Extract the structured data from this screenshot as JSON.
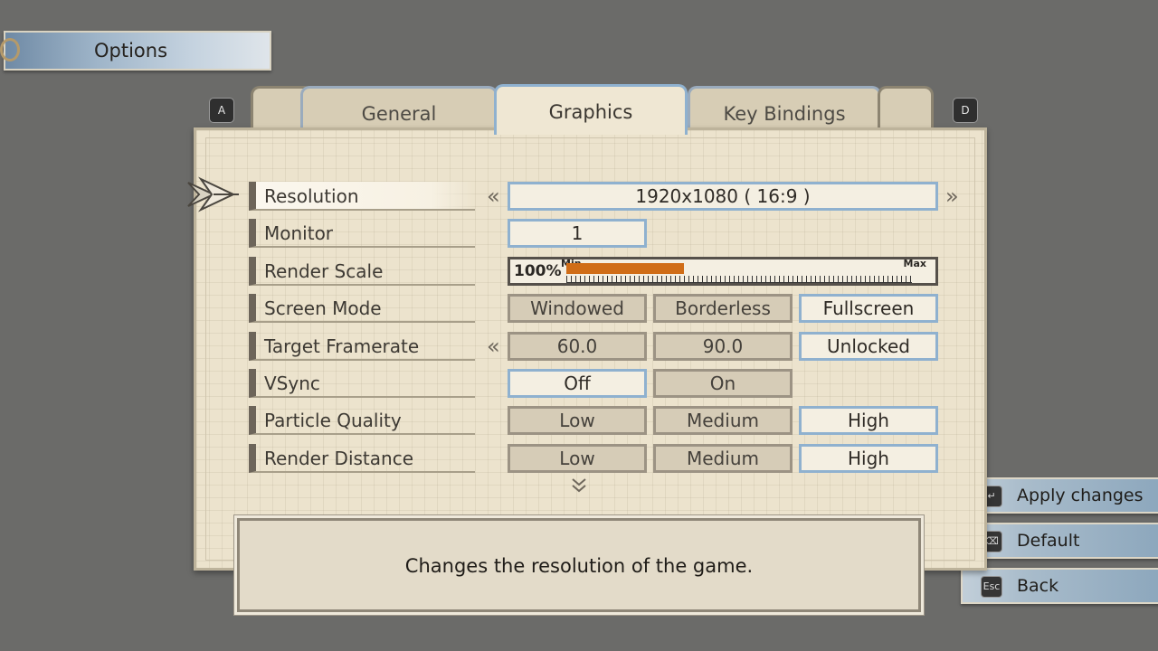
{
  "header": {
    "title": "Options"
  },
  "tab_keys": {
    "left": "A",
    "right": "D"
  },
  "tabs": [
    {
      "label": "General",
      "active": false
    },
    {
      "label": "Graphics",
      "active": true
    },
    {
      "label": "Key Bindings",
      "active": false
    }
  ],
  "settings": {
    "resolution": {
      "label": "Resolution",
      "value": "1920x1080 ( 16:9 )"
    },
    "monitor": {
      "label": "Monitor",
      "value": "1"
    },
    "render_scale": {
      "label": "Render Scale",
      "value_text": "100%",
      "min_label": "Min",
      "max_label": "Max",
      "fill_fraction": 0.34
    },
    "screen_mode": {
      "label": "Screen Mode",
      "options": [
        "Windowed",
        "Borderless",
        "Fullscreen"
      ],
      "selected": "Fullscreen"
    },
    "target_framerate": {
      "label": "Target Framerate",
      "options": [
        "60.0",
        "90.0",
        "Unlocked"
      ],
      "selected": "Unlocked"
    },
    "vsync": {
      "label": "VSync",
      "options": [
        "Off",
        "On"
      ],
      "selected": "Off"
    },
    "particle_quality": {
      "label": "Particle Quality",
      "options": [
        "Low",
        "Medium",
        "High"
      ],
      "selected": "High"
    },
    "render_distance": {
      "label": "Render Distance",
      "options": [
        "Low",
        "Medium",
        "High"
      ],
      "selected": "High"
    }
  },
  "description": "Changes the resolution of the game.",
  "actions": [
    {
      "label": "Apply changes",
      "key": "↵"
    },
    {
      "label": "Default",
      "key": "⌫"
    },
    {
      "label": "Back",
      "key": "Esc"
    }
  ],
  "colors": {
    "slider_fill": "#d06d17",
    "selected_border": "#8fb1cf",
    "panel": "#ece3cd"
  }
}
